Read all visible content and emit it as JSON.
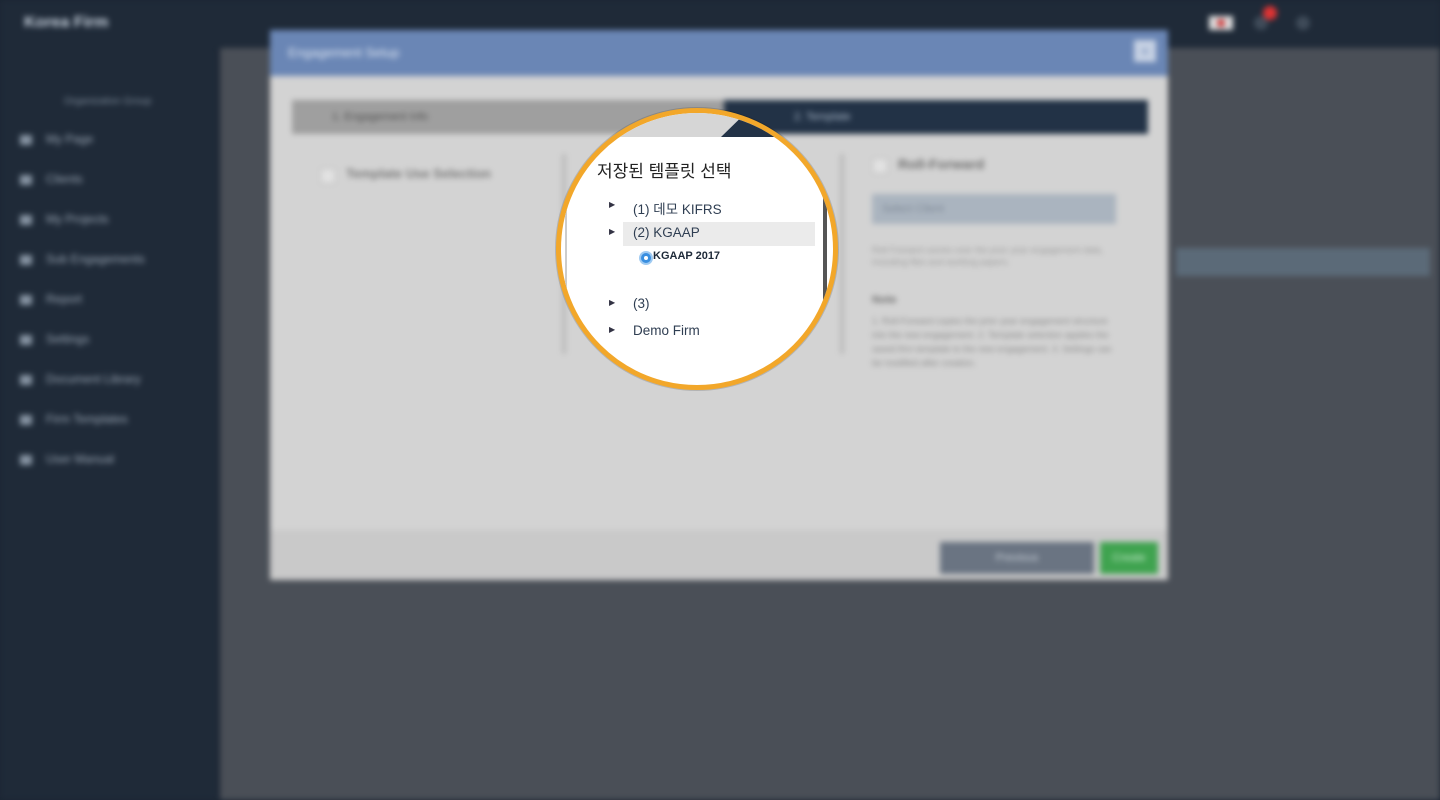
{
  "app": {
    "brand": "Korea Firm"
  },
  "sidebar": {
    "subtitle": "Organization Group",
    "items": [
      {
        "label": "My Page"
      },
      {
        "label": "Clients"
      },
      {
        "label": "My Projects"
      },
      {
        "label": "Sub Engagements"
      },
      {
        "label": "Report"
      },
      {
        "label": "Settings"
      },
      {
        "label": "Document Library"
      },
      {
        "label": "Firm Templates"
      },
      {
        "label": "User Manual"
      }
    ]
  },
  "modal": {
    "title": "Engagement Setup",
    "close_label": "×",
    "tabs": [
      {
        "label": "1. Engagement Info"
      },
      {
        "label": "2. Template"
      }
    ],
    "use_template_label": "Template Use Selection",
    "roll_forward_label": "Roll-Forward",
    "client_select": "Select Client",
    "roll_forward_note": "Roll Forward carries over the prior year engagement data, including files and working papers.",
    "note_title": "Note",
    "note_body": "1. Roll-Forward copies the prior year engagement structure into the new engagement. 2. Template selection applies the saved firm template to the new engagement. 3. Settings can be modified after creation.",
    "back_button": "Previous",
    "create_button": "Create"
  },
  "lens": {
    "title": "저장된 템플릿 선택",
    "tree": [
      {
        "label": "(1) 데모 KIFRS",
        "selected": false
      },
      {
        "label": "(2) KGAAP",
        "selected": true,
        "children": [
          {
            "label": "KGAAP 2017",
            "checked": true
          }
        ]
      },
      {
        "label": "(3)",
        "selected": false
      },
      {
        "label": "Demo Firm",
        "selected": false
      }
    ]
  },
  "colors": {
    "accent": "#f2a72a",
    "header": "#6a86b5",
    "dark_tab": "#223246",
    "radio": "#3a8fe0",
    "create": "#3fa34f"
  }
}
